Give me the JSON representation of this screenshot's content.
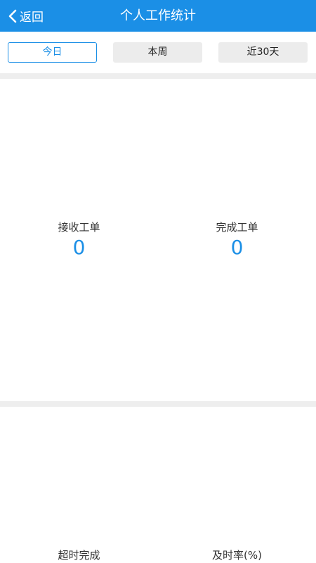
{
  "header": {
    "back_label": "返回",
    "title": "个人工作统计"
  },
  "tabs": [
    {
      "label": "今日",
      "active": true
    },
    {
      "label": "本周",
      "active": false
    },
    {
      "label": "近30天",
      "active": false
    }
  ],
  "stats_panel_1": {
    "received": {
      "label": "接收工单",
      "value": "0"
    },
    "completed": {
      "label": "完成工单",
      "value": "0"
    }
  },
  "stats_panel_2": {
    "overdue": {
      "label": "超时完成"
    },
    "on_time_rate": {
      "label": "及时率(%)"
    }
  },
  "colors": {
    "accent": "#1b8fe6",
    "divider": "#eeeeee",
    "tab_inactive_bg": "#ececec"
  }
}
